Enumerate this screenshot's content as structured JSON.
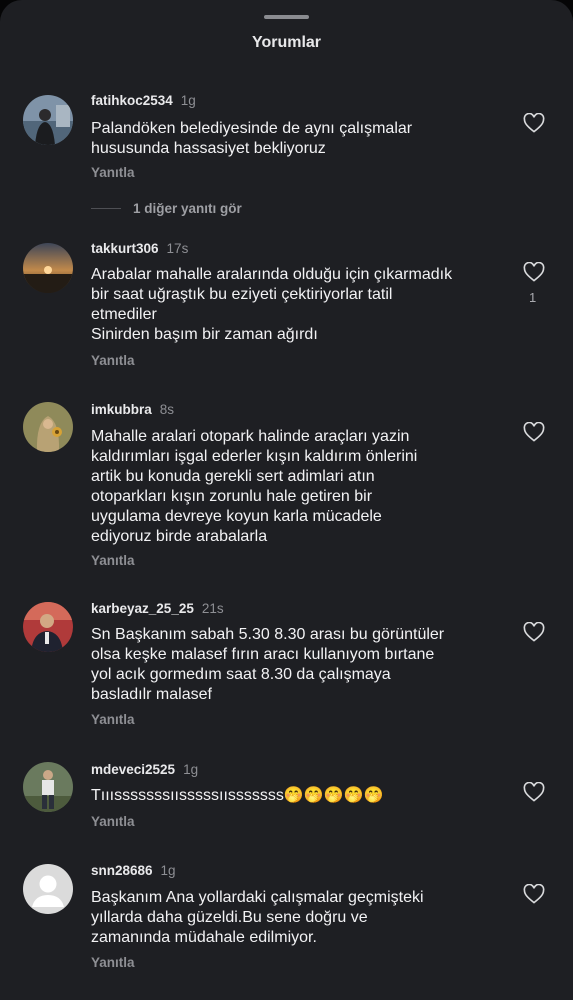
{
  "sheet": {
    "title": "Yorumlar"
  },
  "comments": [
    {
      "username": "fatihkoc2534",
      "time": "1g",
      "lines": [
        "Palandöken belediyesinde de aynı çalışmalar",
        "hususunda hassasiyet bekliyoruz"
      ],
      "reply": "Yanıtla"
    },
    {
      "username": "takkurt306",
      "time": "17s",
      "lines": [
        "Arabalar mahalle aralarında olduğu için çıkarmadık",
        "bir saat uğraştık bu eziyeti çektiriyorlar tatil",
        "etmediler",
        "Sinirden başım bir zaman ağırdı"
      ],
      "reply": "Yanıtla",
      "likes": "1"
    },
    {
      "username": "imkubbra",
      "time": "8s",
      "lines": [
        "Mahalle aralari otopark halinde araçları yazin",
        "kaldırımları işgal ederler kışın kaldırım önlerini",
        "artik bu konuda gerekli sert adimlari atın",
        "otoparkları kışın zorunlu hale getiren bir",
        "uygulama devreye koyun karla mücadele",
        "ediyoruz birde arabalarla"
      ],
      "reply": "Yanıtla"
    },
    {
      "username": "karbeyaz_25_25",
      "time": "21s",
      "lines": [
        "Sn Başkanım sabah 5.30 8.30 arası bu görüntüler",
        "olsa keşke malasef fırın aracı kullanıyom bırtane",
        "yol acık gormedım saat 8.30 da çalışmaya",
        "basladılr malasef"
      ],
      "reply": "Yanıtla"
    },
    {
      "username": "mdeveci2525",
      "time": "1g",
      "text": "Tııısssssssıısssssıısssssss",
      "emojis": "🤭🤭🤭🤭🤭",
      "reply": "Yanıtla"
    },
    {
      "username": "snn28686",
      "time": "1g",
      "lines": [
        "Başkanım Ana yollardaki çalışmalar geçmişteki",
        "yıllarda daha güzeldi.Bu sene doğru ve",
        "zamanında müdahale edilmiyor."
      ],
      "reply": "Yanıtla"
    }
  ],
  "more_replies": "1 diğer yanıtı gör",
  "icons": {
    "like": "heart-outline-icon"
  },
  "colors": {
    "sheet": "#1e1f23",
    "text": "#f2f2f4",
    "muted": "#8e8f94"
  }
}
